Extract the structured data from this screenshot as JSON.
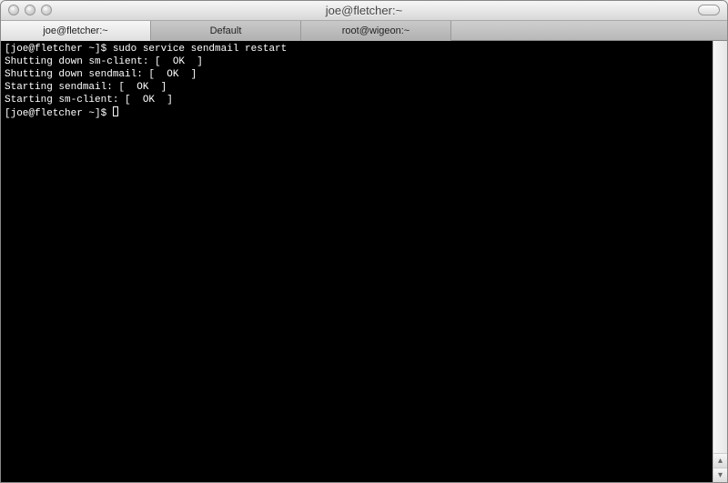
{
  "window": {
    "title": "joe@fletcher:~"
  },
  "tabs": [
    {
      "label": "joe@fletcher:~",
      "active": true
    },
    {
      "label": "Default",
      "active": false
    },
    {
      "label": "root@wigeon:~",
      "active": false
    }
  ],
  "terminal": {
    "lines": [
      "[joe@fletcher ~]$ sudo service sendmail restart",
      "Shutting down sm-client: [  OK  ]",
      "Shutting down sendmail: [  OK  ]",
      "Starting sendmail: [  OK  ]",
      "Starting sm-client: [  OK  ]"
    ],
    "prompt": "[joe@fletcher ~]$ "
  },
  "scroll": {
    "up": "▴",
    "down": "▾"
  }
}
